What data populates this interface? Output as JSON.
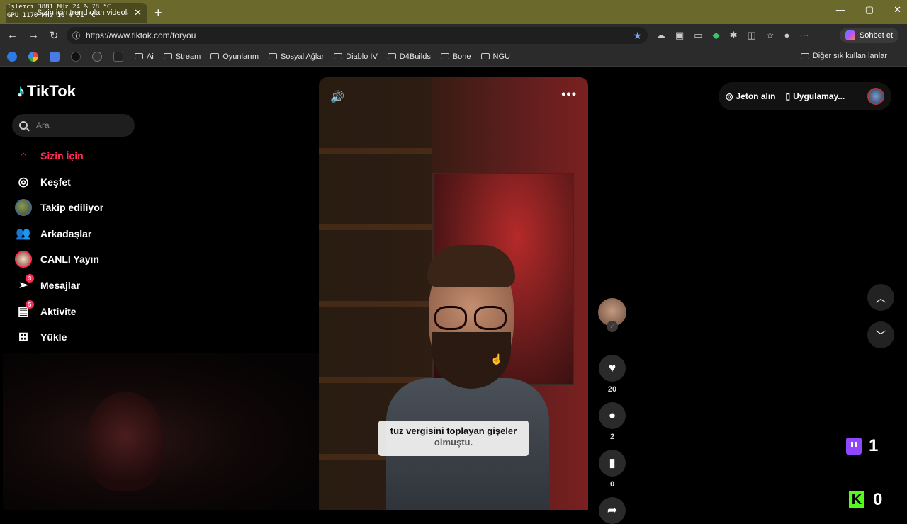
{
  "browser": {
    "stats": {
      "line1": "İşlemci  3881 MHz   24 %   78 °C",
      "line2": "GPU    1170 MHz   16 %   51 °C"
    },
    "tab_title": "Sizin için trend olan videoları",
    "url": "https://www.tiktok.com/foryou",
    "chat_label": "Sohbet et",
    "bookmarks": [
      "Ai",
      "Stream",
      "Oyunlarım",
      "Sosyal Ağlar",
      "Diablo IV",
      "D4Builds",
      "Bone",
      "NGU"
    ],
    "other_bookmarks": "Diğer sık kullanılanlar"
  },
  "tiktok": {
    "logo_text": "TikTok",
    "search_placeholder": "Ara",
    "nav": [
      {
        "label": "Sizin İçin",
        "icon": "home-icon"
      },
      {
        "label": "Keşfet",
        "icon": "compass-icon"
      },
      {
        "label": "Takip ediliyor",
        "icon": "following-avatar"
      },
      {
        "label": "Arkadaşlar",
        "icon": "friends-icon"
      },
      {
        "label": "CANLI Yayın",
        "icon": "live-avatar"
      },
      {
        "label": "Mesajlar",
        "icon": "messages-icon",
        "badge": "3"
      },
      {
        "label": "Aktivite",
        "icon": "activity-icon",
        "badge": "5"
      },
      {
        "label": "Yükle",
        "icon": "upload-icon"
      }
    ],
    "topbar": {
      "coins": "Jeton alın",
      "app": "Uygulamay..."
    },
    "video": {
      "caption_line1": "tuz vergisini toplayan gişeler",
      "caption_line2": "olmuştu."
    },
    "actions": {
      "likes": "20",
      "comments": "2",
      "saves": "0"
    },
    "overlay": {
      "twitch_count": "1",
      "kick_count": "0"
    }
  }
}
